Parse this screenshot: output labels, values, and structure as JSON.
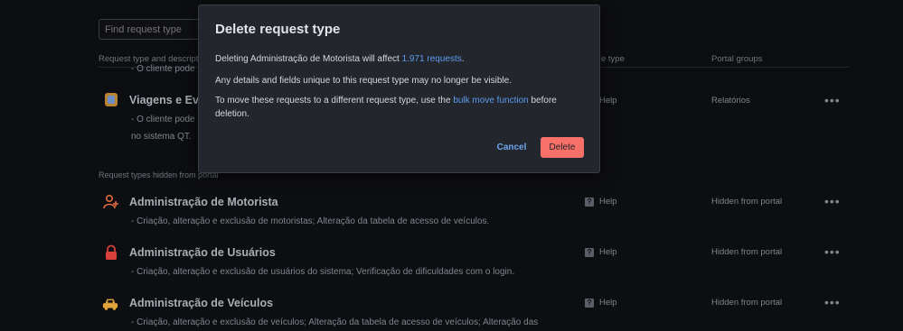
{
  "search": {
    "placeholder": "Find request type"
  },
  "columns": {
    "request_type": "Request type and descriptio",
    "issue_type": "e type",
    "portal_groups": "Portal groups"
  },
  "top_rows": [
    {
      "desc_clip": "- O cliente pode"
    },
    {
      "title": "Viagens e Eve",
      "desc1": "- O cliente pode",
      "desc2": "no sistema QT.",
      "issue_type": "Help",
      "portal_group": "Relatórios"
    }
  ],
  "hidden_section_label": "Request types hidden from portal",
  "hidden_rows": [
    {
      "title": "Administração de Motorista",
      "desc": "- Criação, alteração e exclusão de motoristas; Alteração da tabela de acesso de veículos.",
      "issue_type": "Help",
      "portal_group": "Hidden from portal",
      "icon": "add-person-icon"
    },
    {
      "title": "Administração de Usuários",
      "desc": "- Criação, alteração e exclusão de usuários do sistema; Verificação de dificuldades com o login.",
      "issue_type": "Help",
      "portal_group": "Hidden from portal",
      "icon": "lock-icon"
    },
    {
      "title": "Administração de Veículos",
      "desc": "- Criação, alteração e exclusão de veículos; Alteração da tabela de acesso de veículos; Alteração das",
      "issue_type": "Help",
      "portal_group": "Hidden from portal",
      "icon": "car-icon"
    }
  ],
  "more_label": "•••",
  "dialog": {
    "title": "Delete request type",
    "p1_prefix": "Deleting Administração de Motorista will affect ",
    "p1_link": "1.971 requests",
    "p1_suffix": ".",
    "p2": "Any details and fields unique to this request type may no longer be visible.",
    "p3_prefix": "To move these requests to a different request type, use the ",
    "p3_link": "bulk move function",
    "p3_suffix": " before deletion.",
    "cancel": "Cancel",
    "delete": "Delete"
  },
  "colors": {
    "background": "#0d0e11",
    "dialog": "#23262d",
    "link": "#5c9ded",
    "danger": "#f87168",
    "icon_orange": "#e06a3b",
    "icon_red": "#d9403a",
    "icon_yellow": "#e2a43c"
  }
}
